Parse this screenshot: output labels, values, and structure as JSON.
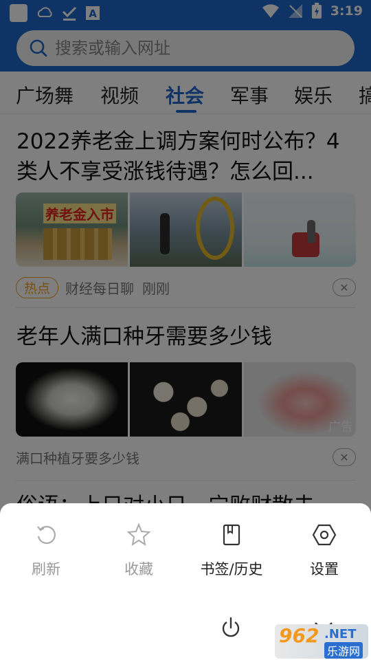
{
  "status_bar": {
    "time": "3:19"
  },
  "search": {
    "placeholder": "搜索或输入网址"
  },
  "tabs": [
    {
      "label": "广场舞"
    },
    {
      "label": "视频"
    },
    {
      "label": "社会",
      "active": true
    },
    {
      "label": "军事"
    },
    {
      "label": "娱乐"
    },
    {
      "label": "搞"
    }
  ],
  "feed": {
    "items": [
      {
        "title": "2022养老金上调方案何时公布？4类人不享受涨钱待遇？怎么回...",
        "thumb_caption": "养老金入市",
        "badge": "热点",
        "source": "财经每日聊",
        "time": "刚刚"
      },
      {
        "title": "老年人满口种牙需要多少钱",
        "ad_label": "广告",
        "source": "满口种植牙要多少钱"
      },
      {
        "title": "俗语：上只对小日，宁败财散去"
      }
    ]
  },
  "menu": {
    "items": [
      {
        "label": "刷新",
        "icon": "refresh-icon",
        "enabled": false
      },
      {
        "label": "收藏",
        "icon": "star-icon",
        "enabled": false
      },
      {
        "label": "书签/历史",
        "icon": "bookmark-icon",
        "enabled": true
      },
      {
        "label": "设置",
        "icon": "settings-hexagon-icon",
        "enabled": true
      }
    ],
    "power_icon": "power-icon",
    "collapse_icon": "chevron-down-icon"
  },
  "watermark": {
    "number": "962",
    "domain": ".NET",
    "text": "乐游网"
  },
  "colors": {
    "header": "#1f67c9",
    "badge": "#f0a020",
    "accent": "#1f67c9"
  }
}
